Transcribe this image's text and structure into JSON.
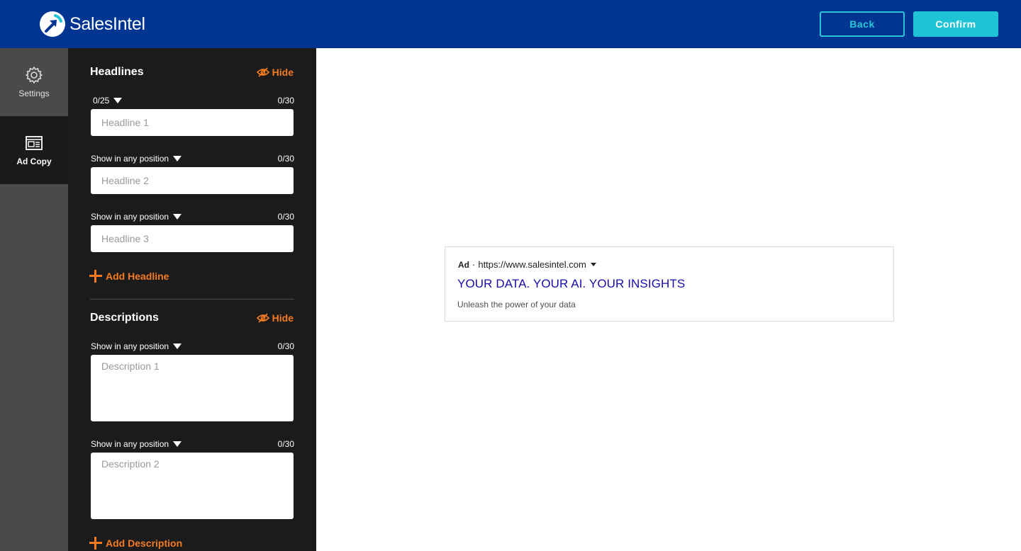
{
  "header": {
    "logo_text": "SalesIntel",
    "back_label": "Back",
    "confirm_label": "Confirm"
  },
  "nav": {
    "items": [
      {
        "label": "Settings",
        "icon": "gear-icon",
        "active": false
      },
      {
        "label": "Ad Copy",
        "icon": "ad-copy-icon",
        "active": true
      }
    ]
  },
  "headlines": {
    "title": "Headlines",
    "hide_label": "Hide",
    "add_label": "Add Headline",
    "items": [
      {
        "position_label": "0/25",
        "count": "0/30",
        "placeholder": "Headline 1",
        "value": ""
      },
      {
        "position_label": "Show in any position",
        "count": "0/30",
        "placeholder": "Headline 2",
        "value": ""
      },
      {
        "position_label": "Show in any position",
        "count": "0/30",
        "placeholder": "Headline 3",
        "value": ""
      }
    ]
  },
  "descriptions": {
    "title": "Descriptions",
    "hide_label": "Hide",
    "add_label": "Add Description",
    "items": [
      {
        "position_label": "Show in any position",
        "count": "0/30",
        "placeholder": "Description 1",
        "value": ""
      },
      {
        "position_label": "Show in any position",
        "count": "0/30",
        "placeholder": "Description 2",
        "value": ""
      }
    ]
  },
  "preview": {
    "badge": "Ad",
    "separator": "·",
    "url": "https://www.salesintel.com",
    "title": "YOUR DATA. YOUR AI. YOUR INSIGHTS",
    "description": "Unleash the power of your data"
  },
  "colors": {
    "header_bg": "#003591",
    "accent_cyan": "#1ec4d6",
    "accent_orange": "#f47b20",
    "panel_bg": "#1b1b1b",
    "nav_bg": "#4a4a4a",
    "ad_title": "#1a0dab"
  }
}
